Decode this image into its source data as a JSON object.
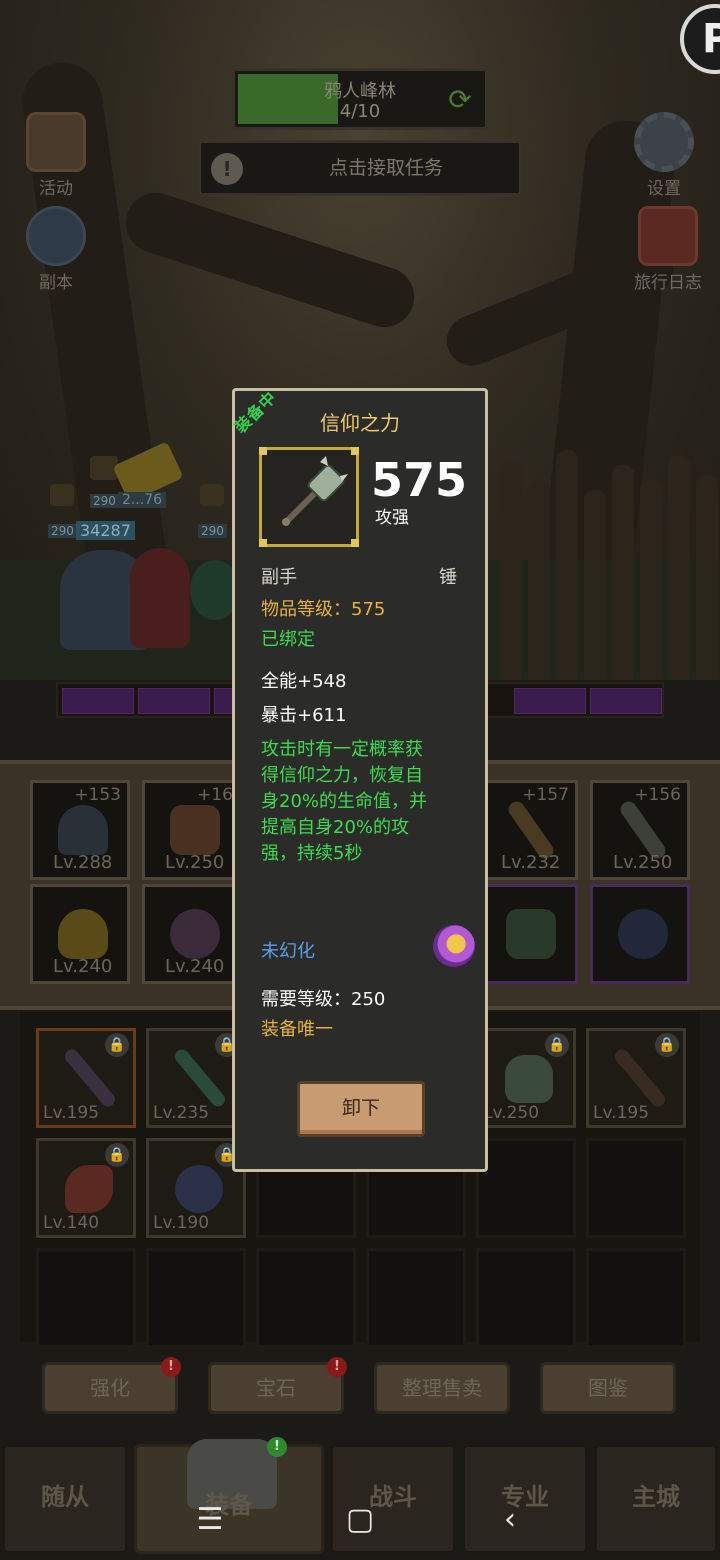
{
  "hud": {
    "zone_name": "鸦人峰林",
    "zone_progress": "4/10",
    "quest_text": "点击接取任务",
    "left_buttons": [
      {
        "label": "活动"
      },
      {
        "label": "副本"
      }
    ],
    "right_buttons": [
      {
        "label": "设置"
      },
      {
        "label": "旅行日志"
      }
    ]
  },
  "heroes": {
    "hp_values": [
      "290",
      "290",
      "290",
      "290"
    ],
    "damage_text": "34287",
    "damage_text_2": "2...76"
  },
  "equipped_slots": [
    {
      "level": "Lv.288",
      "plus": "+153"
    },
    {
      "level": "Lv.250",
      "plus": "+16"
    },
    {
      "level": "Lv.232",
      "plus": "+157"
    },
    {
      "level": "Lv.250",
      "plus": "+156"
    },
    {
      "level": "Lv.240",
      "plus": ""
    },
    {
      "level": "Lv.240",
      "plus": ""
    }
  ],
  "bag_items": [
    {
      "level": "Lv.195"
    },
    {
      "level": "Lv.235"
    },
    {
      "level": "Lv.250"
    },
    {
      "level": "Lv.195"
    },
    {
      "level": "Lv.140"
    },
    {
      "level": "Lv.190"
    }
  ],
  "actions": [
    {
      "label": "强化",
      "badge": "!"
    },
    {
      "label": "宝石",
      "badge": "!"
    },
    {
      "label": "整理售卖",
      "badge": ""
    },
    {
      "label": "图鉴",
      "badge": ""
    }
  ],
  "tabs": [
    {
      "label": "随从"
    },
    {
      "label": "装备"
    },
    {
      "label": "战斗"
    },
    {
      "label": "专业"
    },
    {
      "label": "主城"
    }
  ],
  "tooltip": {
    "equipped_tag": "装备中",
    "name": "信仰之力",
    "power": "575",
    "power_label": "攻强",
    "slot_type": "副手",
    "weapon_type": "锤",
    "item_level": "物品等级：575",
    "bound": "已绑定",
    "stat_1": "全能+548",
    "stat_2": "暴击+611",
    "effect": "攻击时有一定概率获得信仰之力，恢复自身20%的生命值，并提高自身20%的攻强，持续5秒",
    "transmog": "未幻化",
    "required_level": "需要等级：250",
    "unique": "装备唯一",
    "unequip_label": "卸下",
    "colors": {
      "name": "#f0c96a",
      "green": "#3bdc4f",
      "gold": "#e6b23c",
      "blue": "#5aa0e6"
    }
  },
  "top_right_badge": "P",
  "icons": [
    "refresh-icon",
    "alert-icon",
    "gear-icon",
    "book-icon",
    "mace-icon",
    "lock-icon",
    "menu-icon",
    "home-icon",
    "back-icon"
  ]
}
